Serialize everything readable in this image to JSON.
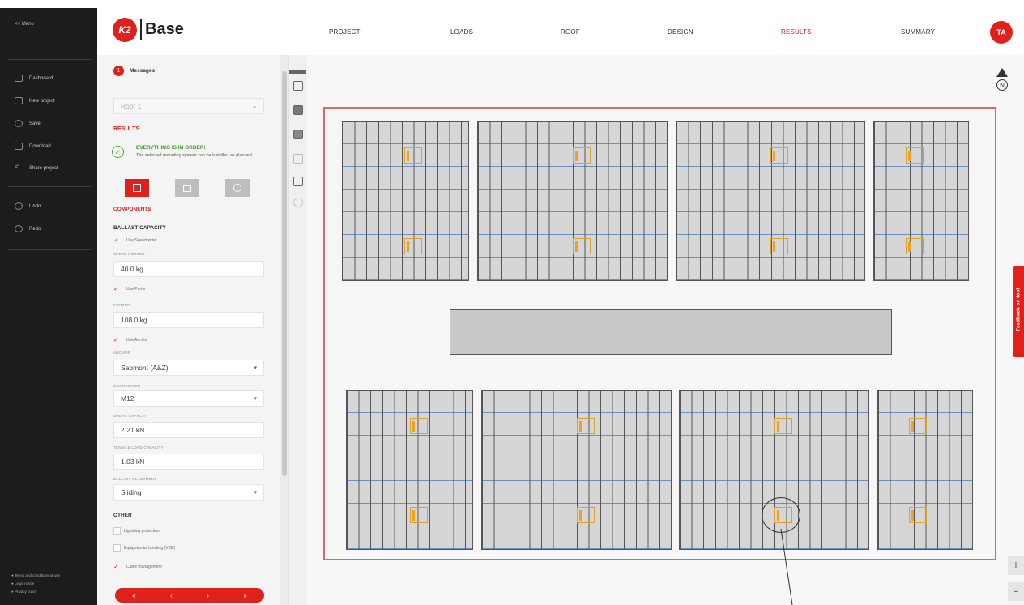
{
  "sidebar": {
    "menu_label": "Menu",
    "items": [
      {
        "label": "Dashboard",
        "icon": "dashboard-icon"
      },
      {
        "label": "New project",
        "icon": "new-project-icon"
      },
      {
        "label": "Save",
        "icon": "save-icon"
      },
      {
        "label": "Download",
        "icon": "download-icon"
      },
      {
        "label": "Share project",
        "icon": "share-icon"
      }
    ],
    "history": [
      {
        "label": "Undo",
        "icon": "undo-icon"
      },
      {
        "label": "Redo",
        "icon": "redo-icon"
      }
    ],
    "footer_links": [
      "Terms and conditions of use",
      "Legal notice",
      "Privacy policy"
    ]
  },
  "header": {
    "logo_text": "K2",
    "app_name": "Base",
    "tabs": [
      "PROJECT",
      "LOADS",
      "ROOF",
      "DESIGN",
      "RESULTS",
      "SUMMARY"
    ],
    "active_tab": "RESULTS",
    "user_initials": "TA"
  },
  "panel": {
    "messages_count": "1",
    "messages_label": "Messages",
    "roof_select": "Roof 1",
    "results_heading": "RESULTS",
    "status_title": "EVERYTHING IS IN ORDER!",
    "status_text": "The selected mounting system can be installed as planned",
    "components_heading": "COMPONENTS",
    "ballast_heading": "BALLAST CAPACITY",
    "use_speedporter": "Use Speedporter",
    "speed_porter_label": "SPEED PORTER",
    "speed_porter_value": "40.0 kg",
    "use_porter": "Use Porter",
    "porter_label": "PORTER",
    "porter_value": "108.0 kg",
    "use_anchor": "Use Anchor",
    "anchor_label": "ANCHOR",
    "anchor_value": "Sabmont (A&Z)",
    "connection_label": "CONNECTION",
    "connection_value": "M12",
    "shear_label": "SHEAR CAPACITY",
    "shear_value": "2.21 kN",
    "tensile_label": "TENSILE LOAD CAPACITY",
    "tensile_value": "1.03 kN",
    "ballast_placement_label": "BALLAST PLACEMENT",
    "ballast_placement_value": "Sliding",
    "other_heading": "OTHER",
    "opt_lightning": "Lightning protection",
    "opt_equipotential": "Equipotential bonding (VDE)",
    "opt_cable": "Cable management"
  },
  "canvas": {
    "north_label": "N",
    "feedback_label": "Feedback on tool",
    "zoom_in": "+",
    "zoom_out": "-"
  }
}
